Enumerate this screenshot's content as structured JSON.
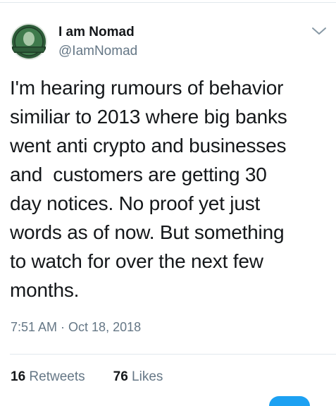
{
  "tweet": {
    "author_name": "I am Nomad",
    "author_handle": "@IamNomad",
    "avatar_text": "GET MONEY",
    "text": "I'm hearing rumours of behavior\nsimiliar to 2013 where big banks\nwent anti crypto and businesses\nand  customers are getting 30\nday notices. No proof yet just\nwords as of now. But something\nto watch for over the next few\nmonths.",
    "time": "7:51 AM",
    "date": "Oct 18, 2018",
    "separator": "·"
  },
  "stats": {
    "retweets_count": "16",
    "retweets_label": "Retweets",
    "likes_count": "76",
    "likes_label": "Likes"
  },
  "colors": {
    "text_primary": "#14171a",
    "text_secondary": "#657786",
    "divider": "#e1e8ed",
    "accent": "#1da1f2"
  },
  "icons": {
    "menu": "chevron-down-icon",
    "fab": "compose-fab"
  }
}
